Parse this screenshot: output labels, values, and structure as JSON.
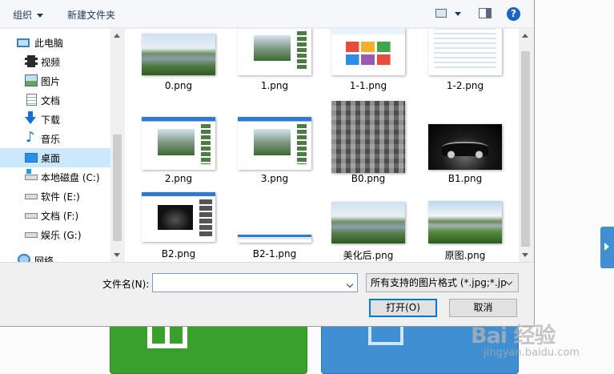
{
  "toolbar": {
    "organize_label": "组织",
    "new_folder_label": "新建文件夹",
    "help_label": "?"
  },
  "nav": {
    "items": [
      {
        "label": "此电脑",
        "icon": "computer-icon"
      },
      {
        "label": "视频",
        "icon": "video-folder-icon"
      },
      {
        "label": "图片",
        "icon": "pictures-folder-icon"
      },
      {
        "label": "文档",
        "icon": "documents-folder-icon"
      },
      {
        "label": "下载",
        "icon": "download-arrow-icon"
      },
      {
        "label": "音乐",
        "icon": "music-note-icon"
      },
      {
        "label": "桌面",
        "icon": "desktop-icon",
        "selected": true
      },
      {
        "label": "本地磁盘 (C:)",
        "icon": "system-drive-icon"
      },
      {
        "label": "软件 (E:)",
        "icon": "drive-icon"
      },
      {
        "label": "文档 (F:)",
        "icon": "drive-icon"
      },
      {
        "label": "娱乐 (G:)",
        "icon": "drive-icon"
      },
      {
        "label": "网络",
        "icon": "network-icon"
      }
    ]
  },
  "files": [
    {
      "name": "0.png",
      "thumb": "lake"
    },
    {
      "name": "1.png",
      "thumb": "screenshot"
    },
    {
      "name": "1-1.png",
      "thumb": "web"
    },
    {
      "name": "1-2.png",
      "thumb": "baidu"
    },
    {
      "name": "2.png",
      "thumb": "screenshot"
    },
    {
      "name": "3.png",
      "thumb": "screenshot"
    },
    {
      "name": "B0.png",
      "thumb": "mosaic"
    },
    {
      "name": "B1.png",
      "thumb": "car"
    },
    {
      "name": "B2.png",
      "thumb": "screenshot-car"
    },
    {
      "name": "B2-1.png",
      "thumb": "strip"
    },
    {
      "name": "美化后.png",
      "thumb": "lake"
    },
    {
      "name": "原图.png",
      "thumb": "original"
    }
  ],
  "footer": {
    "filename_label": "文件名(N):",
    "filename_value": "",
    "filter_value": "所有支持的图片格式 (*.jpg;*.jp",
    "open_label": "打开(O)",
    "cancel_label": "取消"
  },
  "watermark": {
    "logo": "Bai 经验",
    "url": "jingyan.baidu.com"
  },
  "colors": {
    "selected_nav": "#cce8ff",
    "accent": "#0078d7",
    "green_tile": "#3aa02c",
    "blue_tile": "#3f8fd2"
  }
}
